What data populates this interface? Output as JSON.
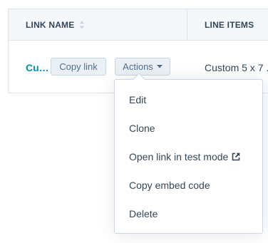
{
  "table": {
    "headers": {
      "link_name": "LINK NAME",
      "line_items": "LINE ITEMS"
    },
    "rows": [
      {
        "name": "Cu…",
        "copy_link_label": "Copy link",
        "actions_label": "Actions",
        "line_items": "Custom 5 x 7 ."
      }
    ]
  },
  "actions_menu": {
    "items": [
      {
        "label": "Edit"
      },
      {
        "label": "Clone"
      },
      {
        "label": "Open link in test mode",
        "icon": "external-link-icon"
      },
      {
        "label": "Copy embed code"
      },
      {
        "label": "Delete"
      }
    ]
  },
  "colors": {
    "link": "#0091ae",
    "text": "#33475b",
    "header_bg": "#f5f8fa",
    "border": "#dfe3eb",
    "button_bg": "#eaf0f6"
  }
}
